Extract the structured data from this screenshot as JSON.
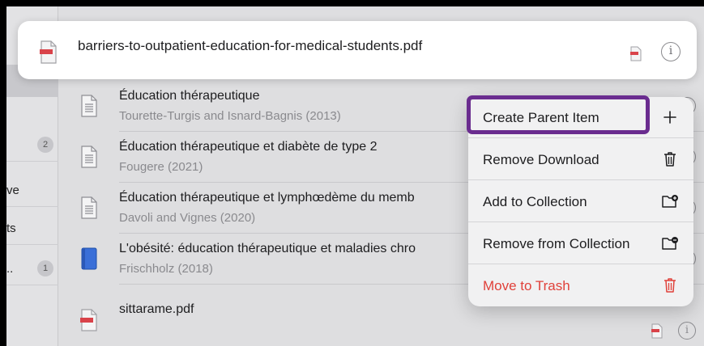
{
  "sidebar": {
    "rows": [
      {
        "text": "",
        "badge": "2"
      },
      {
        "text": "ve",
        "badge": ""
      },
      {
        "text": "ts",
        "badge": ""
      },
      {
        "text": "..",
        "badge": "1"
      }
    ]
  },
  "top_sheet": {
    "filename": "barriers-to-outpatient-education-for-medical-students.pdf",
    "info_glyph": "i",
    "icon": "pdf-icon"
  },
  "items": [
    {
      "title": "Éducation thérapeutique",
      "subtitle": "Tourette-Turgis and Isnard-Bagnis (2013)",
      "icon": "document-icon"
    },
    {
      "title": "Éducation thérapeutique et diabète de type 2",
      "subtitle": "Fougere (2021)",
      "icon": "document-icon"
    },
    {
      "title": "Éducation thérapeutique et lymphœdème du memb",
      "subtitle": "Davoli and Vignes (2020)",
      "icon": "document-icon"
    },
    {
      "title": "L'obésité: éducation thérapeutique et maladies chro",
      "subtitle": "Frischholz (2018)",
      "icon": "book-icon"
    },
    {
      "title": "sittarame.pdf",
      "subtitle": "",
      "icon": "pdf-icon"
    }
  ],
  "row_info_glyph": "i",
  "context_menu": {
    "items": [
      {
        "label": "Create Parent Item",
        "icon": "plus-icon"
      },
      {
        "label": "Remove Download",
        "icon": "trash-icon"
      },
      {
        "label": "Add to Collection",
        "icon": "folder-add-icon"
      },
      {
        "label": "Remove from Collection",
        "icon": "folder-remove-icon"
      },
      {
        "label": "Move to Trash",
        "icon": "trash-icon",
        "destructive": true
      }
    ]
  },
  "colors": {
    "highlight": "#6a2c8f",
    "destructive": "#e0413a",
    "pdf_red": "#d9434a"
  }
}
